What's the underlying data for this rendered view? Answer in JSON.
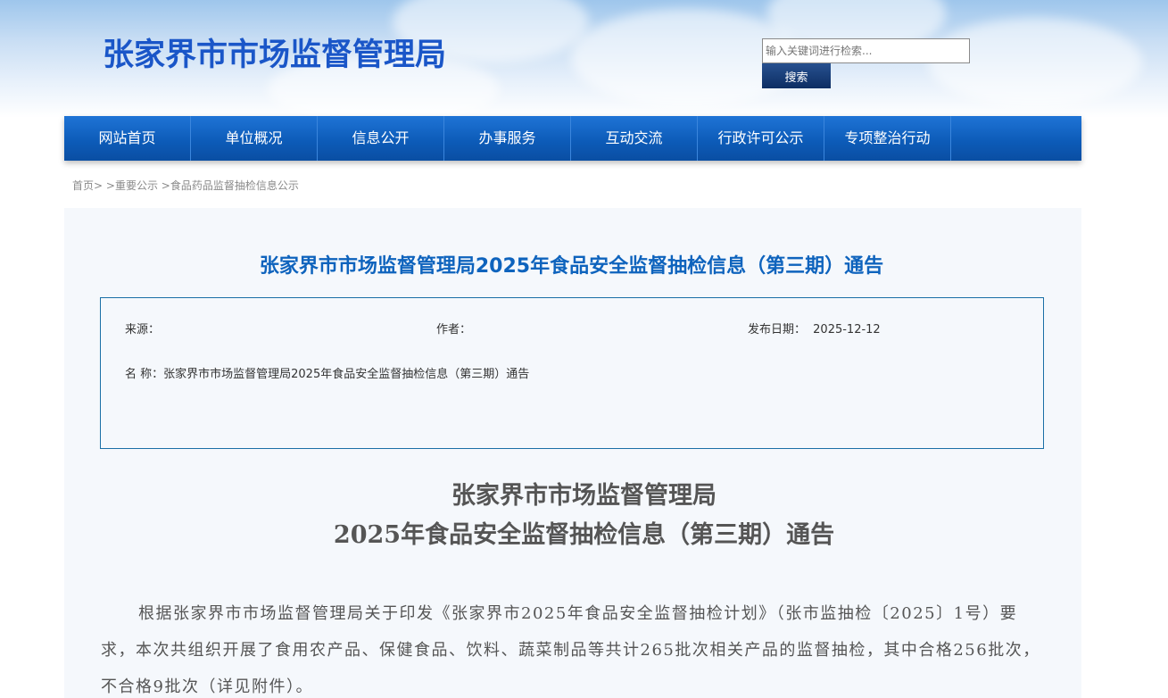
{
  "header": {
    "site_title": "张家界市市场监督管理局",
    "search_placeholder": "输入关键词进行检索...",
    "search_button": "搜索"
  },
  "nav": {
    "items": [
      {
        "label": "网站首页"
      },
      {
        "label": "单位概况"
      },
      {
        "label": "信息公开"
      },
      {
        "label": "办事服务"
      },
      {
        "label": "互动交流"
      },
      {
        "label": "行政许可公示"
      },
      {
        "label": "专项整治行动"
      }
    ]
  },
  "breadcrumb": {
    "home": "首页>",
    "level1": ">重要公示",
    "level2": ">食品药品监督抽检信息公示"
  },
  "article": {
    "title": "张家界市市场监督管理局2025年食品安全监督抽检信息（第三期）通告",
    "info": {
      "source_label": "来源：",
      "author_label": "作者：",
      "date_label": "发布日期：",
      "date_value": "2025-12-12",
      "name_label": "名 称：",
      "name_value": "张家界市市场监督管理局2025年食品安全监督抽检信息（第三期）通告"
    },
    "doc_title_line1": "张家界市市场监督管理局",
    "doc_title_line2": "2025年食品安全监督抽检信息（第三期）通告",
    "paragraph": "根据张家界市市场监督管理局关于印发《张家界市2025年食品安全监督抽检计划》（张市监抽检〔2025〕1号）要求，本次共组织开展了食用农产品、保健食品、饮料、蔬菜制品等共计265批次相关产品的监督抽检，其中合格256批次，不合格9批次（详见附件）。"
  },
  "colors": {
    "title_blue": "#1a56c8",
    "nav_blue": "#0d5cb9",
    "article_title_blue": "#0e63bd",
    "box_border": "#1a6fa6",
    "search_button": "#1a3d78"
  }
}
